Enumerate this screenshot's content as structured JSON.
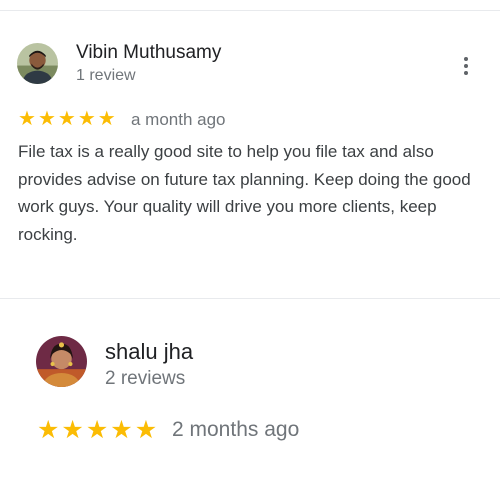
{
  "reviews": [
    {
      "reviewer": "Vibin Muthusamy",
      "review_count": "1 review",
      "rating": 5,
      "time": "a month ago",
      "text": "File tax is a really good site to help you file tax and also provides advise on future tax planning. Keep doing the good work guys. Your quality will drive you more clients, keep rocking.",
      "menu_icon": "more-vert-icon"
    },
    {
      "reviewer": "shalu jha",
      "review_count": "2 reviews",
      "rating": 5,
      "time": "2 months ago"
    }
  ],
  "colors": {
    "star": "#fbbc04",
    "secondary_text": "#70757a",
    "divider": "#e8eaed"
  }
}
